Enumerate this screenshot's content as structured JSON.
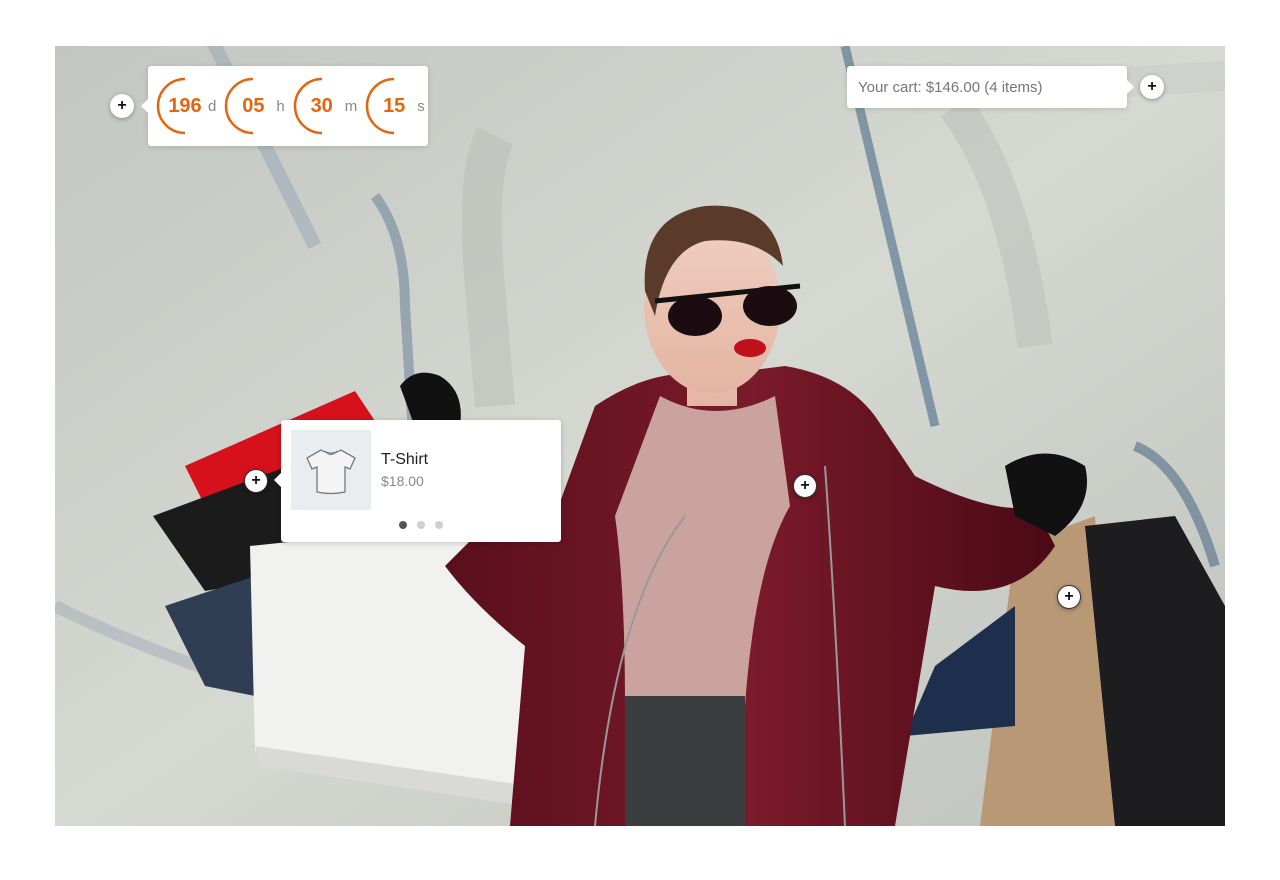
{
  "countdown": {
    "units": [
      {
        "value": "196",
        "label": "d"
      },
      {
        "value": "05",
        "label": "h"
      },
      {
        "value": "30",
        "label": "m"
      },
      {
        "value": "15",
        "label": "s"
      }
    ],
    "accent_color": "#e46510"
  },
  "cart": {
    "summary": "Your cart: $146.00 (4 items)"
  },
  "product_popup": {
    "name": "T-Shirt",
    "price": "$18.00",
    "carousel_pages": 3,
    "active_page": 1
  },
  "hotspots": {
    "icon": "plus-icon",
    "symbol": "+"
  }
}
